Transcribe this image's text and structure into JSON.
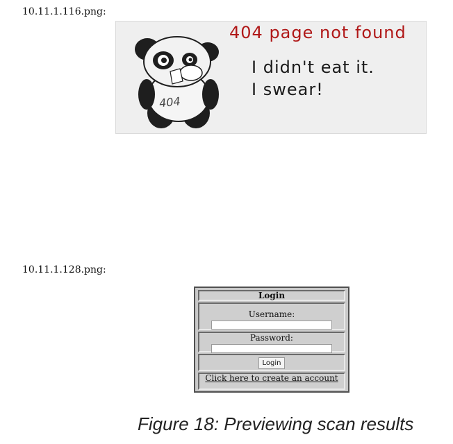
{
  "screenshots": [
    {
      "filename": "10.11.1.116.png:"
    },
    {
      "filename": "10.11.1.128.png:"
    }
  ],
  "page404": {
    "title": "404 page not found",
    "line1": "I didn't eat it.",
    "line2": "I swear!",
    "panda_shirt": "404"
  },
  "login": {
    "title": "Login",
    "username_label": "Username:",
    "password_label": "Password:",
    "button": "Login",
    "create_link": "Click here to create an account"
  },
  "caption": "Figure 18: Previewing scan results",
  "colors": {
    "error_red": "#b01818",
    "panel_bg": "#efefef",
    "login_bg": "#c8c8c8"
  }
}
